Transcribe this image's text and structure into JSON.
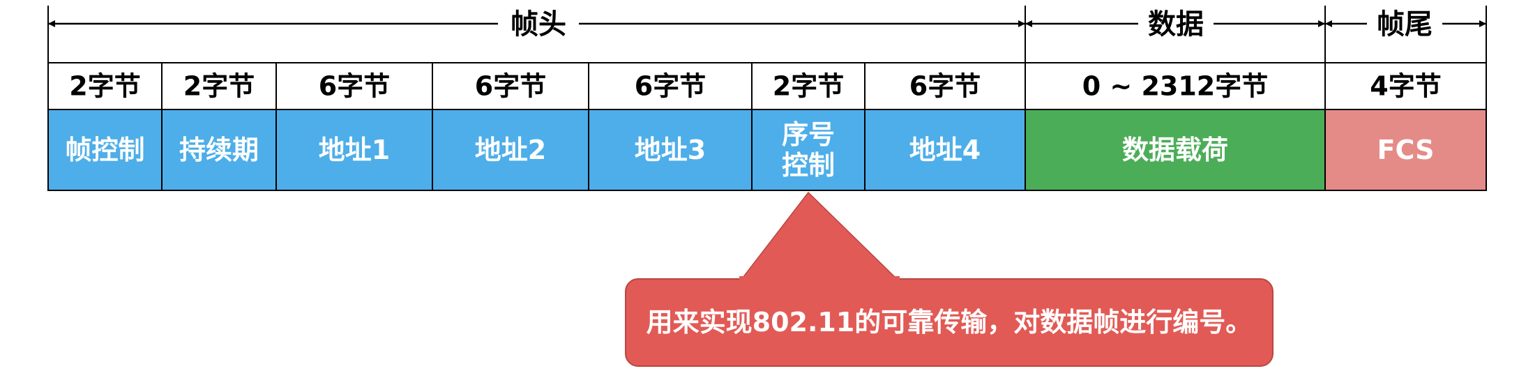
{
  "sections": {
    "header": "帧头",
    "data": "数据",
    "trailer": "帧尾"
  },
  "fields": [
    {
      "size": "2字节",
      "name": [
        "帧控制"
      ],
      "color": "#4daee9"
    },
    {
      "size": "2字节",
      "name": [
        "持续期"
      ],
      "color": "#4daee9"
    },
    {
      "size": "6字节",
      "name": [
        "地址1"
      ],
      "color": "#4daee9"
    },
    {
      "size": "6字节",
      "name": [
        "地址2"
      ],
      "color": "#4daee9"
    },
    {
      "size": "6字节",
      "name": [
        "地址3"
      ],
      "color": "#4daee9"
    },
    {
      "size": "2字节",
      "name": [
        "序号",
        "控制"
      ],
      "color": "#4daee9"
    },
    {
      "size": "6字节",
      "name": [
        "地址4"
      ],
      "color": "#4daee9"
    },
    {
      "size": "0 ~ 2312字节",
      "name": [
        "数据载荷"
      ],
      "color": "#4cad58"
    },
    {
      "size": "4字节",
      "name": [
        "FCS"
      ],
      "color": "#e58b87"
    }
  ],
  "callout": {
    "text": "用来实现802.11的可靠传输，对数据帧进行编号。",
    "color": "#e25a55",
    "target_field": 5
  }
}
